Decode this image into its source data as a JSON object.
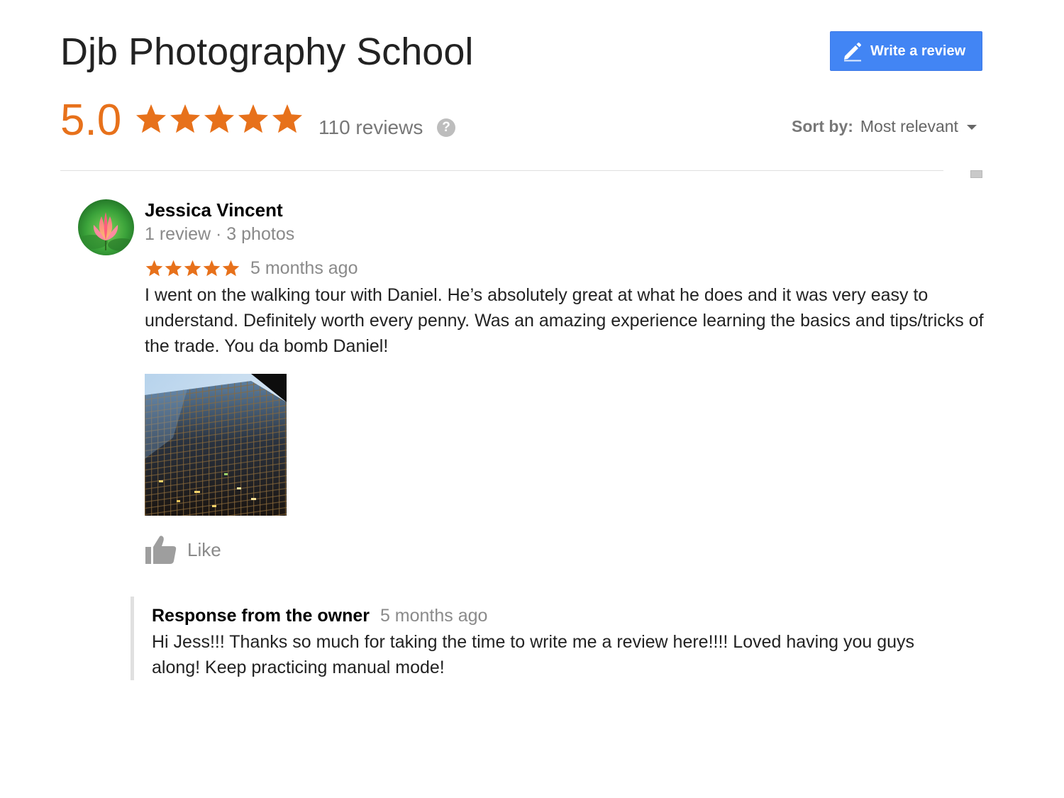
{
  "place": {
    "title": "Djb Photography School"
  },
  "actions": {
    "write_review_label": "Write a review",
    "write_review_icon": "pencil-icon"
  },
  "summary": {
    "rating": "5.0",
    "rating_value": 5,
    "stars_max": 5,
    "reviews_count": "110 reviews",
    "help_icon_label": "?",
    "accent_color": "#e7711b"
  },
  "sort": {
    "label": "Sort by:",
    "value": "Most relevant"
  },
  "reviews": [
    {
      "author": "Jessica Vincent",
      "author_meta": "1 review · 3 photos",
      "rating_value": 5,
      "time_ago": "5 months ago",
      "text": "I went on the walking tour with Daniel. He’s absolutely great at what he does and it was very easy to understand. Definitely worth every penny. Was an amazing experience learning the basics and tips/tricks of the trade. You da bomb Daniel!",
      "like_label": "Like",
      "owner_response": {
        "label": "Response from the owner",
        "time_ago": "5 months ago",
        "text": "Hi Jess!!! Thanks so much for taking the time to write me a review here!!!! Loved having you guys along! Keep practicing manual mode!"
      }
    }
  ],
  "colors": {
    "button_blue": "#4285f4",
    "star_orange": "#e7711b",
    "muted_text": "#8a8a8a"
  }
}
